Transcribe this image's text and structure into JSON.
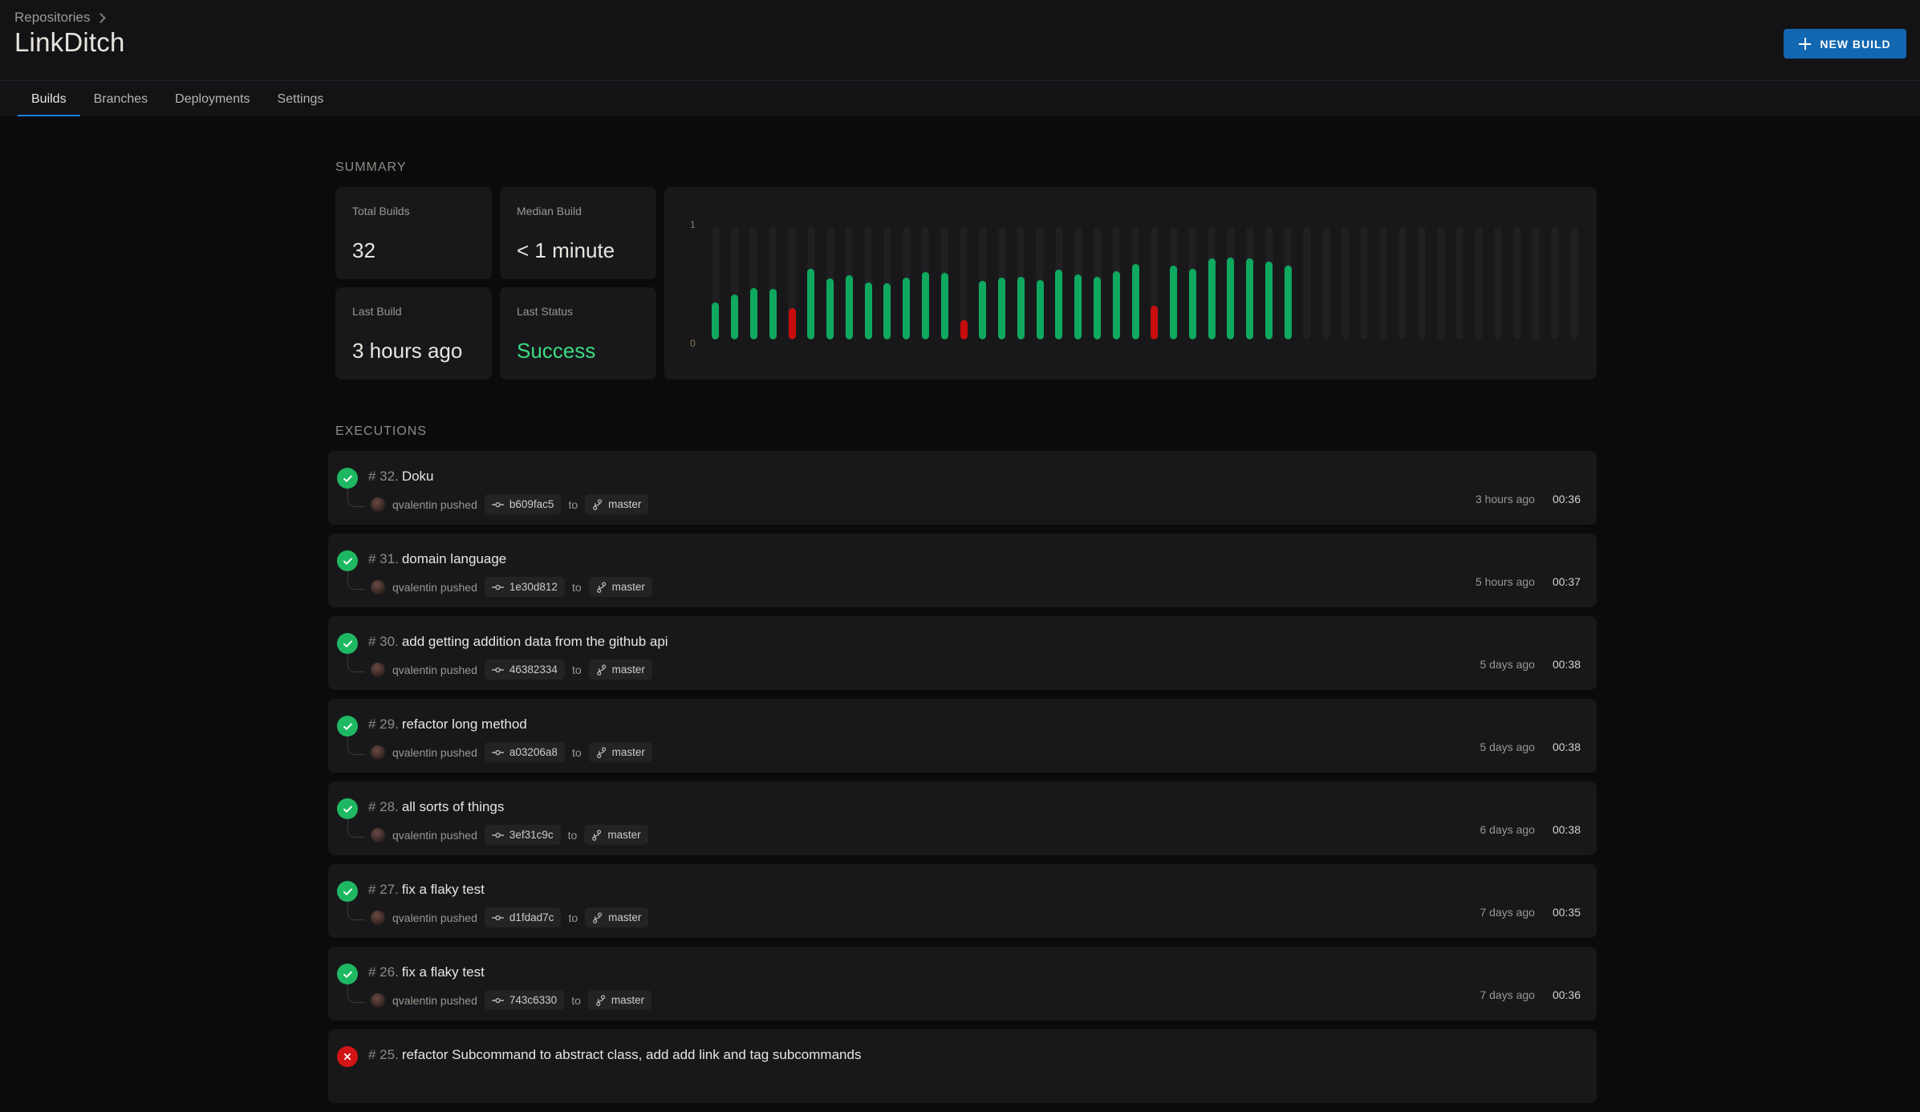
{
  "header": {
    "breadcrumb": {
      "root": "Repositories",
      "chevron_icon": "chevron-right-icon"
    },
    "title": "LinkDitch",
    "new_build_label": "NEW BUILD",
    "new_build_icon": "plus-icon",
    "accent_color": "#1267b1"
  },
  "tabs": [
    {
      "label": "Builds",
      "active": true
    },
    {
      "label": "Branches",
      "active": false
    },
    {
      "label": "Deployments",
      "active": false
    },
    {
      "label": "Settings",
      "active": false
    }
  ],
  "summary": {
    "label": "SUMMARY",
    "cards": [
      {
        "label": "Total Builds",
        "value": "32",
        "success": false
      },
      {
        "label": "Median Build",
        "value": "< 1 minute",
        "success": false
      },
      {
        "label": "Last Build",
        "value": "3 hours ago",
        "success": false
      },
      {
        "label": "Last Status",
        "value": "Success",
        "success": true
      }
    ]
  },
  "chart_data": {
    "type": "bar",
    "title": "",
    "xlabel": "",
    "ylabel": "",
    "ylim": [
      0,
      1
    ],
    "ytick_labels": [
      "1",
      "0"
    ],
    "grid": false,
    "legend": null,
    "slot_count": 46,
    "colors": {
      "ok": "#0fa85f",
      "fail": "#c70d0d",
      "track": "#202023"
    },
    "bars": [
      {
        "value": 0.33,
        "status": "ok"
      },
      {
        "value": 0.4,
        "status": "ok"
      },
      {
        "value": 0.46,
        "status": "ok"
      },
      {
        "value": 0.45,
        "status": "ok"
      },
      {
        "value": 0.28,
        "status": "fail"
      },
      {
        "value": 0.63,
        "status": "ok"
      },
      {
        "value": 0.54,
        "status": "ok"
      },
      {
        "value": 0.57,
        "status": "ok"
      },
      {
        "value": 0.51,
        "status": "ok"
      },
      {
        "value": 0.5,
        "status": "ok"
      },
      {
        "value": 0.55,
        "status": "ok"
      },
      {
        "value": 0.6,
        "status": "ok"
      },
      {
        "value": 0.59,
        "status": "ok"
      },
      {
        "value": 0.17,
        "status": "fail"
      },
      {
        "value": 0.52,
        "status": "ok"
      },
      {
        "value": 0.55,
        "status": "ok"
      },
      {
        "value": 0.56,
        "status": "ok"
      },
      {
        "value": 0.53,
        "status": "ok"
      },
      {
        "value": 0.62,
        "status": "ok"
      },
      {
        "value": 0.58,
        "status": "ok"
      },
      {
        "value": 0.56,
        "status": "ok"
      },
      {
        "value": 0.61,
        "status": "ok"
      },
      {
        "value": 0.67,
        "status": "ok"
      },
      {
        "value": 0.3,
        "status": "fail"
      },
      {
        "value": 0.66,
        "status": "ok"
      },
      {
        "value": 0.63,
        "status": "ok"
      },
      {
        "value": 0.72,
        "status": "ok"
      },
      {
        "value": 0.73,
        "status": "ok"
      },
      {
        "value": 0.72,
        "status": "ok"
      },
      {
        "value": 0.69,
        "status": "ok"
      },
      {
        "value": 0.66,
        "status": "ok"
      },
      {
        "value": 0,
        "status": "none"
      },
      {
        "value": 0,
        "status": "none"
      },
      {
        "value": 0,
        "status": "none"
      },
      {
        "value": 0,
        "status": "none"
      },
      {
        "value": 0,
        "status": "none"
      },
      {
        "value": 0,
        "status": "none"
      },
      {
        "value": 0,
        "status": "none"
      },
      {
        "value": 0,
        "status": "none"
      },
      {
        "value": 0,
        "status": "none"
      },
      {
        "value": 0,
        "status": "none"
      },
      {
        "value": 0,
        "status": "none"
      },
      {
        "value": 0,
        "status": "none"
      },
      {
        "value": 0,
        "status": "none"
      },
      {
        "value": 0,
        "status": "none"
      },
      {
        "value": 0,
        "status": "none"
      }
    ]
  },
  "executions": {
    "label": "EXECUTIONS",
    "to_word": "to",
    "pushed_text": "qvalentin pushed",
    "commit_icon": "git-commit-icon",
    "branch_icon": "git-branch-icon",
    "rows": [
      {
        "status": "ok",
        "number": "# 32.",
        "title": "Doku",
        "author": "qvalentin pushed",
        "commit": "b609fac5",
        "branch": "master",
        "when": "3 hours ago",
        "duration": "00:36"
      },
      {
        "status": "ok",
        "number": "# 31.",
        "title": "domain language",
        "author": "qvalentin pushed",
        "commit": "1e30d812",
        "branch": "master",
        "when": "5 hours ago",
        "duration": "00:37"
      },
      {
        "status": "ok",
        "number": "# 30.",
        "title": "add getting addition data from the github api",
        "author": "qvalentin pushed",
        "commit": "46382334",
        "branch": "master",
        "when": "5 days ago",
        "duration": "00:38"
      },
      {
        "status": "ok",
        "number": "# 29.",
        "title": "refactor long method",
        "author": "qvalentin pushed",
        "commit": "a03206a8",
        "branch": "master",
        "when": "5 days ago",
        "duration": "00:38"
      },
      {
        "status": "ok",
        "number": "# 28.",
        "title": "all sorts of things",
        "author": "qvalentin pushed",
        "commit": "3ef31c9c",
        "branch": "master",
        "when": "6 days ago",
        "duration": "00:38"
      },
      {
        "status": "ok",
        "number": "# 27.",
        "title": "fix a flaky test",
        "author": "qvalentin pushed",
        "commit": "d1fdad7c",
        "branch": "master",
        "when": "7 days ago",
        "duration": "00:35"
      },
      {
        "status": "ok",
        "number": "# 26.",
        "title": "fix a flaky test",
        "author": "qvalentin pushed",
        "commit": "743c6330",
        "branch": "master",
        "when": "7 days ago",
        "duration": "00:36"
      },
      {
        "status": "fail",
        "number": "# 25.",
        "title": "refactor Subcommand to abstract class, add add link and tag subcommands",
        "author": "",
        "commit": "",
        "branch": "",
        "when": "",
        "duration": ""
      }
    ]
  }
}
